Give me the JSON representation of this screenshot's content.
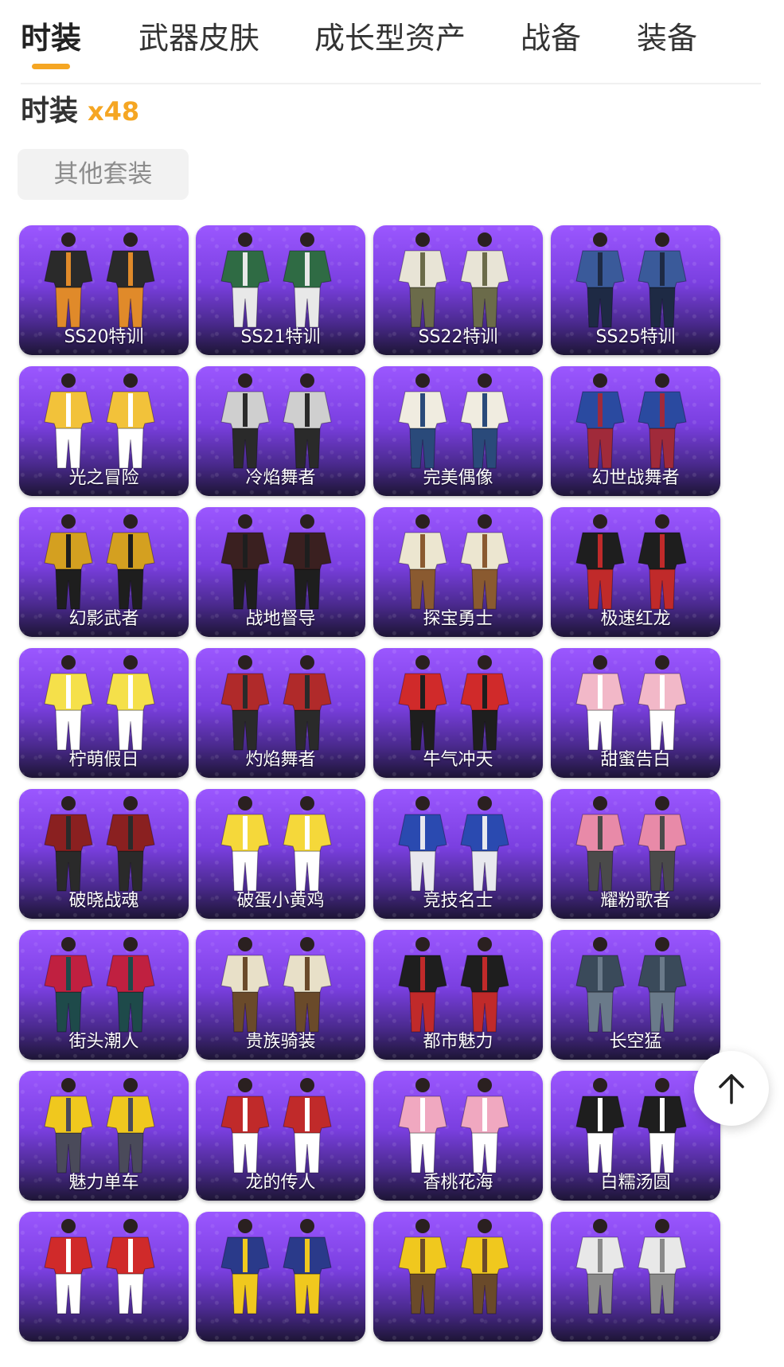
{
  "tabs": [
    {
      "label": "时装",
      "active": true
    },
    {
      "label": "武器皮肤",
      "active": false
    },
    {
      "label": "成长型资产",
      "active": false
    },
    {
      "label": "战备",
      "active": false
    },
    {
      "label": "装备",
      "active": false
    }
  ],
  "section": {
    "title": "时装",
    "count": "x48"
  },
  "filter": {
    "label": "其他套装"
  },
  "colors": {
    "accent": "#f5a623",
    "card_top": "#9b57ff",
    "card_bottom": "#1d1535"
  },
  "items": [
    {
      "name": "SS20特训",
      "palette": [
        "#2a2a2a",
        "#e08a2a"
      ]
    },
    {
      "name": "SS21特训",
      "palette": [
        "#2f6b44",
        "#e8e8e8"
      ]
    },
    {
      "name": "SS22特训",
      "palette": [
        "#e8e4d6",
        "#6b6b4a"
      ]
    },
    {
      "name": "SS25特训",
      "palette": [
        "#3a5a9a",
        "#1e2a44"
      ]
    },
    {
      "name": "光之冒险",
      "palette": [
        "#f2c23a",
        "#ffffff"
      ]
    },
    {
      "name": "冷焰舞者",
      "palette": [
        "#cfcfcf",
        "#2a2a2a"
      ]
    },
    {
      "name": "完美偶像",
      "palette": [
        "#f0ece0",
        "#2a4a7a"
      ]
    },
    {
      "name": "幻世战舞者",
      "palette": [
        "#2a4aa0",
        "#a02a3a"
      ]
    },
    {
      "name": "幻影武者",
      "palette": [
        "#d4a020",
        "#1e1e1e"
      ]
    },
    {
      "name": "战地督导",
      "palette": [
        "#3a2020",
        "#1e1e1e"
      ]
    },
    {
      "name": "探宝勇士",
      "palette": [
        "#ece6d0",
        "#8a5a30"
      ]
    },
    {
      "name": "极速红龙",
      "palette": [
        "#1e1e1e",
        "#c02a2a"
      ]
    },
    {
      "name": "柠萌假日",
      "palette": [
        "#f5e04a",
        "#ffffff"
      ]
    },
    {
      "name": "灼焰舞者",
      "palette": [
        "#b02a2a",
        "#2a2a2a"
      ]
    },
    {
      "name": "牛气冲天",
      "palette": [
        "#d02a2a",
        "#1e1e1e"
      ]
    },
    {
      "name": "甜蜜告白",
      "palette": [
        "#f2b8c8",
        "#ffffff"
      ]
    },
    {
      "name": "破晓战魂",
      "palette": [
        "#8a2020",
        "#2a2a2a"
      ]
    },
    {
      "name": "破蛋小黄鸡",
      "palette": [
        "#f5d83a",
        "#ffffff"
      ]
    },
    {
      "name": "竞技名士",
      "palette": [
        "#2a4ab0",
        "#e8e8ee"
      ]
    },
    {
      "name": "耀粉歌者",
      "palette": [
        "#e88aa8",
        "#4a4a4a"
      ]
    },
    {
      "name": "街头潮人",
      "palette": [
        "#c02040",
        "#1e4a4a"
      ]
    },
    {
      "name": "贵族骑装",
      "palette": [
        "#e8e0c8",
        "#6a4a2a"
      ]
    },
    {
      "name": "都市魅力",
      "palette": [
        "#1e1e1e",
        "#c02a2a"
      ]
    },
    {
      "name": "长空猛",
      "palette": [
        "#3a4a5a",
        "#6a7a8a"
      ]
    },
    {
      "name": "魅力单车",
      "palette": [
        "#f0c81e",
        "#4a4a5a"
      ]
    },
    {
      "name": "龙的传人",
      "palette": [
        "#c02a2a",
        "#ffffff"
      ]
    },
    {
      "name": "香桃花海",
      "palette": [
        "#f0a8c0",
        "#ffffff"
      ]
    },
    {
      "name": "白糯汤圆",
      "palette": [
        "#1e1e1e",
        "#ffffff"
      ]
    },
    {
      "name": "",
      "palette": [
        "#d02a2a",
        "#ffffff"
      ]
    },
    {
      "name": "",
      "palette": [
        "#2a3a8a",
        "#f0c81e"
      ]
    },
    {
      "name": "",
      "palette": [
        "#f0c81e",
        "#6a4a2a"
      ]
    },
    {
      "name": "",
      "palette": [
        "#e8e8e8",
        "#8a8a8a"
      ]
    }
  ]
}
